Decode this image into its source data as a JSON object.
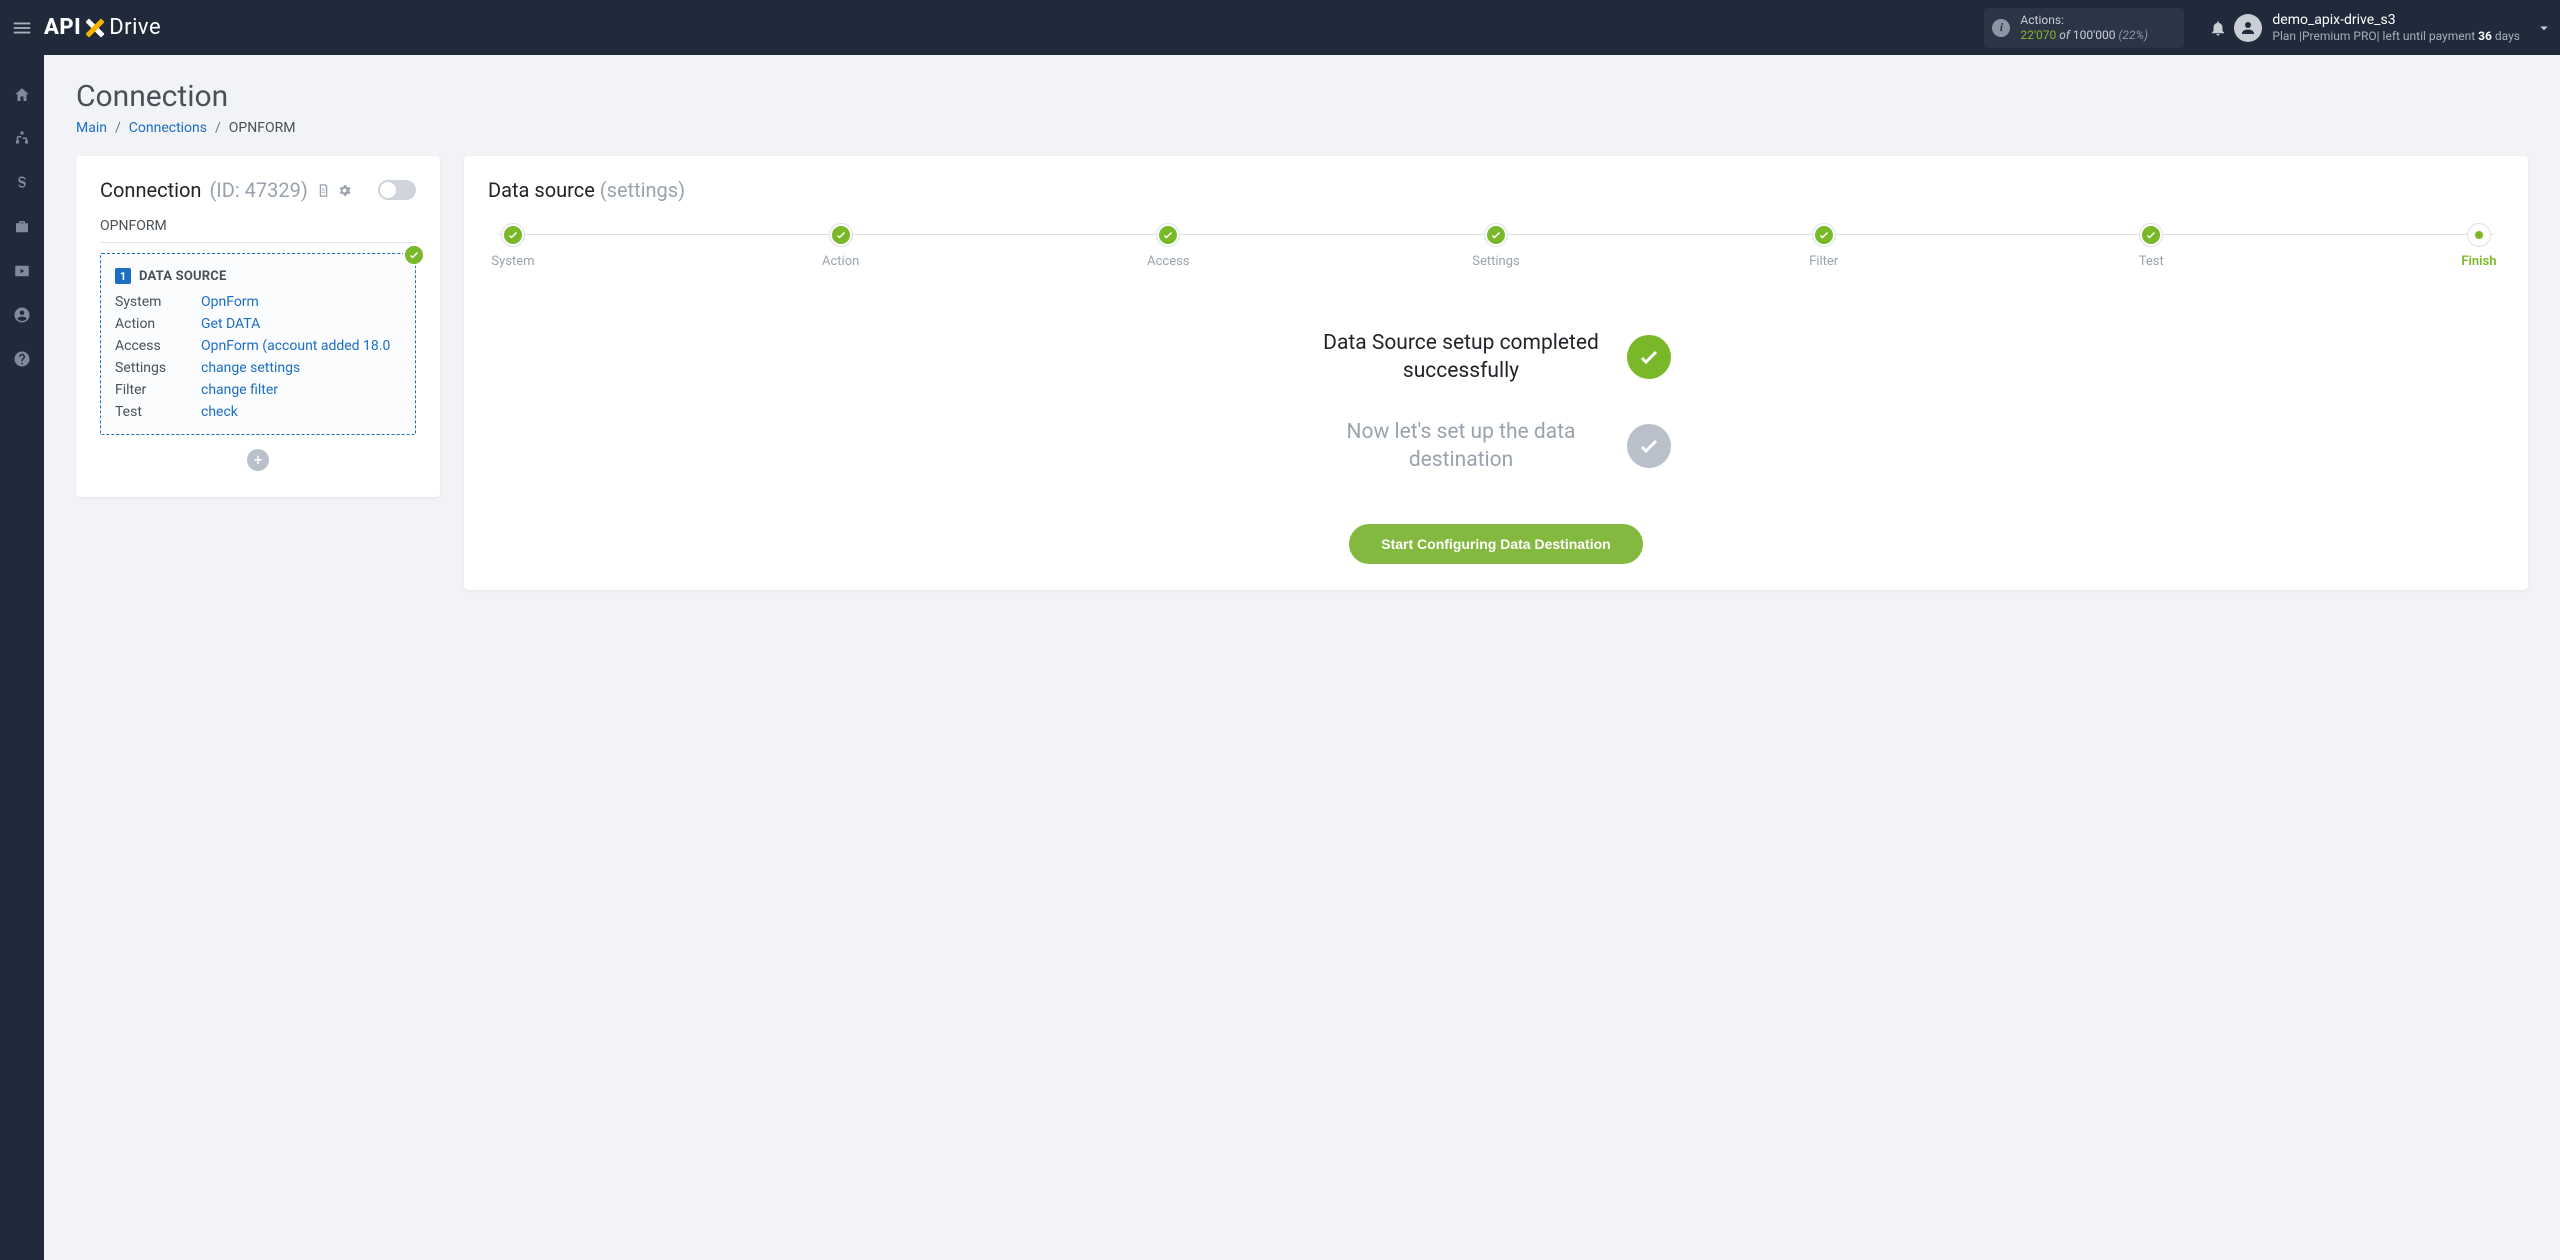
{
  "logo": {
    "left": "API",
    "right": "Drive"
  },
  "header": {
    "actions_label": "Actions:",
    "actions_used": "22'070",
    "actions_of": "of",
    "actions_total": "100'000",
    "actions_pct": "(22%)",
    "username": "demo_apix-drive_s3",
    "plan_prefix": "Plan |",
    "plan_name": "Premium PRO",
    "plan_mid": "| left until payment ",
    "plan_days": "36",
    "plan_suffix": " days"
  },
  "page": {
    "title": "Connection",
    "breadcrumb": [
      "Main",
      "Connections",
      "OPNFORM"
    ]
  },
  "left_card": {
    "title": "Connection",
    "id_label": "(ID: 47329)",
    "connection_name": "OPNFORM",
    "ds_num": "1",
    "ds_title": "DATA SOURCE",
    "rows": [
      {
        "k": "System",
        "v": "OpnForm"
      },
      {
        "k": "Action",
        "v": "Get DATA"
      },
      {
        "k": "Access",
        "v": "OpnForm (account added 18.0"
      },
      {
        "k": "Settings",
        "v": "change settings"
      },
      {
        "k": "Filter",
        "v": "change filter"
      },
      {
        "k": "Test",
        "v": "check"
      }
    ]
  },
  "right_card": {
    "title": "Data source",
    "subtitle": "(settings)",
    "steps": [
      "System",
      "Action",
      "Access",
      "Settings",
      "Filter",
      "Test",
      "Finish"
    ],
    "msg_done": "Data Source setup completed successfully",
    "msg_pending": "Now let's set up the data destination",
    "cta": "Start Configuring Data Destination"
  }
}
